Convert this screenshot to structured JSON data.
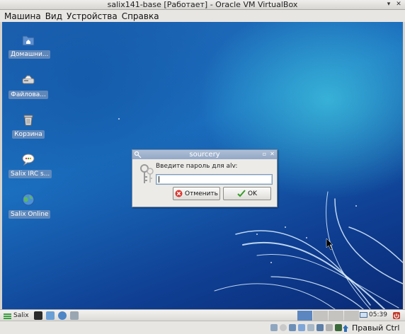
{
  "window": {
    "title": "salix141-base [Работает] - Oracle VM VirtualBox",
    "minimize_glyph": "▾",
    "close_glyph": "✕"
  },
  "menu": {
    "items": [
      "Машина",
      "Вид",
      "Устройства",
      "Справка"
    ]
  },
  "desktop_icons": [
    {
      "label": "Домашни...",
      "icon": "home-folder-icon"
    },
    {
      "label": "Файлова...",
      "icon": "drive-icon"
    },
    {
      "label": "Корзина",
      "icon": "trash-icon"
    },
    {
      "label": "Salix IRC s...",
      "icon": "chat-icon"
    },
    {
      "label": "Salix Online",
      "icon": "globe-icon"
    }
  ],
  "dialog": {
    "title": "sourcery",
    "prompt": "Введите пароль для alv:",
    "password_value": "",
    "cancel_label": "Отменить",
    "ok_label": "OK"
  },
  "taskbar": {
    "start_label": "Salix",
    "quick_launch": [
      "terminal-icon",
      "file-manager-icon",
      "browser-icon",
      "text-editor-icon"
    ],
    "workspaces": 4,
    "active_workspace": 1,
    "clock": "05:39"
  },
  "statusbar": {
    "host_key": "Правый Ctrl",
    "indicators": [
      "hdd-icon",
      "cd-icon",
      "usb-icon",
      "shared-folder-icon",
      "display-icon",
      "network-icon",
      "capture-icon",
      "mouse-icon"
    ]
  },
  "colors": {
    "desktop_dark": "#0a2a75",
    "desktop_light": "#3cbedc",
    "dialog_title": "#93a8c6",
    "active_workspace": "#5c86bf"
  }
}
